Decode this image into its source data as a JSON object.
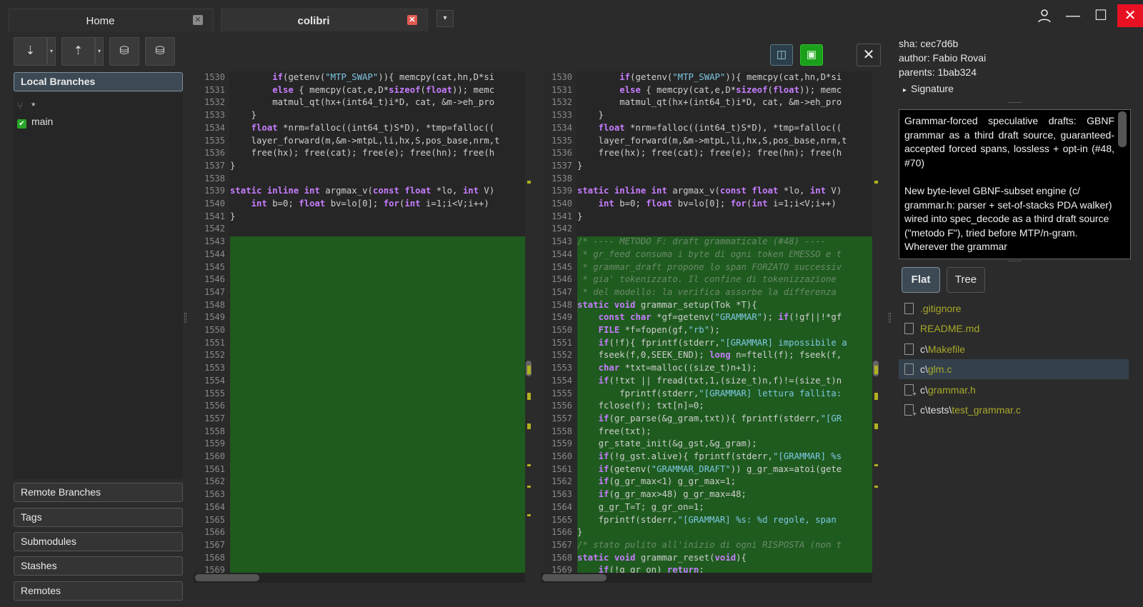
{
  "tabs": [
    {
      "label": "Home",
      "close": "✕"
    },
    {
      "label": "colibri",
      "close": "✕"
    }
  ],
  "tab_menu": "▾",
  "window": {
    "user": "👤",
    "min": "—",
    "max": "☐",
    "close": "✕"
  },
  "toolbar": {
    "fetch": "⇣",
    "push": "⇡",
    "stash": "⛁",
    "pop": "⛁",
    "drop": "▾"
  },
  "left": {
    "local_branches": "Local Branches",
    "branches": [
      {
        "label": "*",
        "icon": "⑂"
      },
      {
        "label": "main",
        "icon": "✔"
      }
    ],
    "remote_branches": "Remote Branches",
    "tags": "Tags",
    "submodules": "Submodules",
    "stashes": "Stashes",
    "remotes": "Remotes"
  },
  "diff_toolbar": {
    "split": "◫",
    "unified": "▣",
    "close": "✕"
  },
  "left_pane": {
    "lines": [
      "1530",
      "1531",
      "1532",
      "1533",
      "1534",
      "1535",
      "1536",
      "1537",
      "1538",
      "1539",
      "1540",
      "1541",
      "1542",
      "1543",
      "1544",
      "1545",
      "1546",
      "1547",
      "1548",
      "1549",
      "1550",
      "1551",
      "1552",
      "1553",
      "1554",
      "1555",
      "1556",
      "1557",
      "1558",
      "1559",
      "1560",
      "1561",
      "1562",
      "1563",
      "1564",
      "1565",
      "1566",
      "1567",
      "1568",
      "1569"
    ],
    "code": [
      "        if(getenv(\"MTP_SWAP\")){ memcpy(cat,hn,D*si",
      "        else { memcpy(cat,e,D*sizeof(float)); memc",
      "        matmul_qt(hx+(int64_t)i*D, cat, &m->eh_pro",
      "    }",
      "    float *nrm=falloc((int64_t)S*D), *tmp=falloc((",
      "    layer_forward(m,&m->mtpL,li,hx,S,pos_base,nrm,t",
      "    free(hx); free(cat); free(e); free(hn); free(h",
      "}",
      "",
      "static inline int argmax_v(const float *lo, int V)",
      "    int b=0; float bv=lo[0]; for(int i=1;i<V;i++)",
      "}"
    ]
  },
  "right_pane": {
    "lines": [
      "1530",
      "1531",
      "1532",
      "1533",
      "1534",
      "1535",
      "1536",
      "1537",
      "1538",
      "1539",
      "1540",
      "1541",
      "1542",
      "1543",
      "1544",
      "1545",
      "1546",
      "1547",
      "1548",
      "1549",
      "1550",
      "1551",
      "1552",
      "1553",
      "1554",
      "1555",
      "1556",
      "1557",
      "1558",
      "1559",
      "1560",
      "1561",
      "1562",
      "1563",
      "1564",
      "1565",
      "1566",
      "1567",
      "1568",
      "1569"
    ],
    "code": [
      "        if(getenv(\"MTP_SWAP\")){ memcpy(cat,hn,D*si",
      "        else { memcpy(cat,e,D*sizeof(float)); memc",
      "        matmul_qt(hx+(int64_t)i*D, cat, &m->eh_pro",
      "    }",
      "    float *nrm=falloc((int64_t)S*D), *tmp=falloc((",
      "    layer_forward(m,&m->mtpL,li,hx,S,pos_base,nrm,t",
      "    free(hx); free(cat); free(e); free(hn); free(h",
      "}",
      "",
      "static inline int argmax_v(const float *lo, int V)",
      "    int b=0; float bv=lo[0]; for(int i=1;i<V;i++)",
      "}",
      "",
      "/* ---- METODO F: draft grammaticale (#48) ----",
      " * gr_feed consuma i byte di ogni token EMESSO e t",
      " * grammar_draft propone lo span FORZATO successiv",
      " * gia' tokenizzato. Il confine di tokenizzazione ",
      " * del modello: la verifica assorbe la differenza ",
      "static void grammar_setup(Tok *T){",
      "    const char *gf=getenv(\"GRAMMAR\"); if(!gf||!*gf",
      "    FILE *f=fopen(gf,\"rb\");",
      "    if(!f){ fprintf(stderr,\"[GRAMMAR] impossibile a",
      "    fseek(f,0,SEEK_END); long n=ftell(f); fseek(f,",
      "    char *txt=malloc((size_t)n+1);",
      "    if(!txt || fread(txt,1,(size_t)n,f)!=(size_t)n",
      "        fprintf(stderr,\"[GRAMMAR] lettura fallita:",
      "    fclose(f); txt[n]=0;",
      "    if(gr_parse(&g_gram,txt)){ fprintf(stderr,\"[GR",
      "    free(txt);",
      "    gr_state_init(&g_gst,&g_gram);",
      "    if(!g_gst.alive){ fprintf(stderr,\"[GRAMMAR] %s ",
      "    if(getenv(\"GRAMMAR_DRAFT\")) g_gr_max=atoi(gete",
      "    if(g_gr_max<1) g_gr_max=1;",
      "    if(g_gr_max>48) g_gr_max=48;",
      "    g_gr_T=T; g_gr_on=1;",
      "    fprintf(stderr,\"[GRAMMAR] %s: %d regole, span ",
      "}",
      "/* stato pulito all'inizio di ogni RISPOSTA (non t",
      "static void grammar_reset(void){",
      "    if(!g_gr_on) return;"
    ]
  },
  "commit": {
    "sha": "sha: cec7d6b",
    "author": "author: Fabio Rovai",
    "parents": "parents: 1bab324",
    "signature": "Signature",
    "signature_arrow": "▸",
    "message_p1": "Grammar-forced speculative drafts: GBNF grammar as a third draft source, guaranteed-accepted forced spans, lossless + opt-in (#48, #70)",
    "message_p2": "New byte-level GBNF-subset engine (c/ grammar.h: parser + set-of-stacks PDA walker) wired into spec_decode as a third draft source (\"metodo F\"), tried before MTP/n-gram. Wherever the grammar"
  },
  "view_buttons": {
    "flat": "Flat",
    "tree": "Tree"
  },
  "files": [
    {
      "dir": "",
      "name": ".gitignore"
    },
    {
      "dir": "",
      "name": "README.md"
    },
    {
      "dir": "c\\",
      "name": "Makefile"
    },
    {
      "dir": "c\\",
      "name": "glm.c"
    },
    {
      "dir": "c\\",
      "name": "grammar.h"
    },
    {
      "dir": "c\\tests\\",
      "name": "test_grammar.c"
    }
  ],
  "colors": {
    "added": "#1f5b1f",
    "keyword": "#c77dff",
    "string": "#7ec8e3",
    "comment": "#6a8a6a",
    "file_name": "#a8a82a",
    "selection": "#34414c",
    "accent_green": "#1aa01a"
  }
}
